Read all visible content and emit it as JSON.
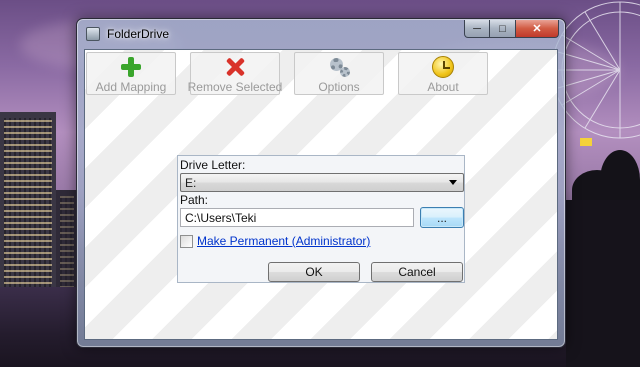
{
  "window": {
    "title": "FolderDrive",
    "caption_buttons": {
      "minimize": "─",
      "maximize": "□",
      "close": "✕"
    }
  },
  "toolbar": {
    "add_mapping": {
      "label": "Add Mapping",
      "icon": "plus-icon"
    },
    "remove_selected": {
      "label": "Remove Selected",
      "icon": "x-icon"
    },
    "options": {
      "label": "Options",
      "icon": "gear-icon"
    },
    "about": {
      "label": "About",
      "icon": "clock-icon"
    }
  },
  "mapping": {
    "drive_letter_label": "Drive Letter:",
    "drive_letter_value": "E:",
    "path_label": "Path:",
    "path_value": "C:\\Users\\Teki",
    "browse_label": "...",
    "permanent_label": "Make Permanent (Administrator)",
    "permanent_checked": false,
    "ok_label": "OK",
    "cancel_label": "Cancel"
  },
  "colors": {
    "accent_link": "#0033cc",
    "add_icon": "#3aa52c",
    "remove_icon": "#d9322a",
    "close_button": "#c0392b"
  }
}
